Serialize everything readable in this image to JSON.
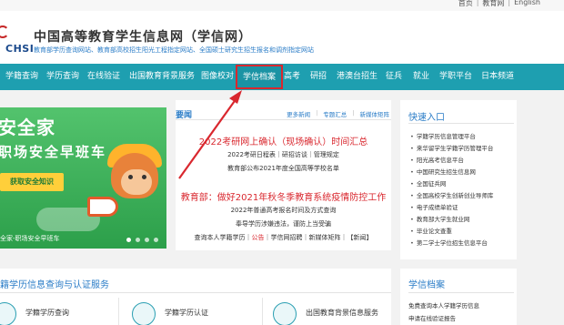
{
  "toplinks": {
    "home": "首页",
    "edu": "教育网",
    "english": "English"
  },
  "header": {
    "logo_text": "CHSI",
    "title": "中国高等教育学生信息网（学信网）",
    "subtitle": "教育部学历查询网站、教育部高校招生阳光工程指定网站、全国硕士研究生招生报名和调剂指定网站"
  },
  "nav": {
    "items": [
      "学籍查询",
      "学历查询",
      "在线验证",
      "出国教育背景服务",
      "图像校对",
      "学信档案",
      "高考",
      "研招",
      "港澳台招生",
      "征兵",
      "就业",
      "学职平台",
      "日本频道"
    ],
    "active_index": 5
  },
  "banner": {
    "title1": "安全家",
    "title2": "职场安全早班车",
    "button": "获取安全知识",
    "footer": "全家-职场安全早班车"
  },
  "news": {
    "heading": "要闻",
    "links": [
      "更多新闻",
      "专题汇总",
      "新媒体矩阵"
    ],
    "headline1": "2022考研网上确认（现场确认）时间汇总",
    "sub1": "2022考研日程表｜研招访谈｜管理规定",
    "sub2": "教育部公布2021年度全国高等学校名单",
    "headline2": "教育部：做好2021年秋冬季教育系统疫情防控工作",
    "sub3": "2022年普通高考报名时间及方式查询",
    "sub4": "奉导学历涉嫌违法，谨防上当受骗",
    "sub5_a": "查询本人学籍学历｜",
    "sub5_b": "公告",
    "sub5_c": "｜学信网招聘｜新媒体矩阵｜【新闻】"
  },
  "quick": {
    "title": "快速入口",
    "items": [
      "学籍学历信息管理平台",
      "来华留学生学籍学历管理平台",
      "阳光高考信息平台",
      "中国研究生招生信息网",
      "全国征兵网",
      "全国高校学生创新创业导师库",
      "电子成绩单验证",
      "教育部大学生就业网",
      "毕业论文查重",
      "第二学士学位招生信息平台"
    ]
  },
  "verify": {
    "title": "籍学历信息查询与认证服务",
    "services": [
      "学籍学历查询",
      "学籍学历认证",
      "出国教育背景信息服务"
    ]
  },
  "archive": {
    "title": "学信档案",
    "items": [
      "免费查询本人学籍学历信息",
      "申请在线验证报告"
    ]
  },
  "colors": {
    "nav_bg": "#1e9fb0",
    "accent_red": "#d9272e",
    "link_blue": "#2a7cc7",
    "banner_green": "#30a852"
  }
}
